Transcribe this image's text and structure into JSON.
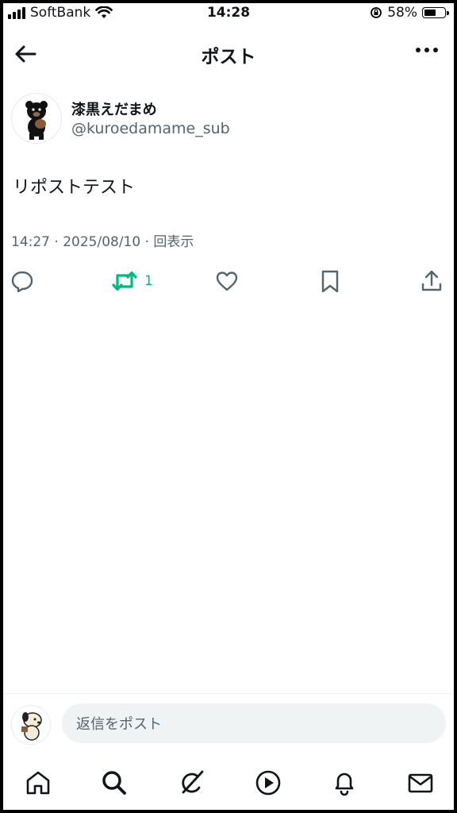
{
  "status_bar": {
    "carrier": "SoftBank",
    "time": "14:28",
    "battery_percent": "58%",
    "battery_level": 0.58,
    "icons": [
      "signal-icon",
      "wifi-icon",
      "orientation-lock-icon",
      "battery-icon"
    ]
  },
  "header": {
    "title": "ポスト",
    "back_icon": "arrow-left-icon",
    "more_icon": "more-horizontal-icon"
  },
  "post": {
    "author": {
      "display_name": "漆黒えだまめ",
      "handle": "@kuroedamame_sub"
    },
    "text": "リポストテスト",
    "timestamp": "14:27 · 2025/08/10 · 回表示",
    "actions": {
      "reply_icon": "reply-icon",
      "repost_icon": "repost-icon",
      "repost_count": "1",
      "like_icon": "heart-icon",
      "bookmark_icon": "bookmark-icon",
      "share_icon": "share-icon"
    }
  },
  "reply_bar": {
    "placeholder": "返信をポスト"
  },
  "tab_bar": {
    "items": [
      "home",
      "search",
      "grok",
      "video",
      "notifications",
      "messages"
    ]
  },
  "colors": {
    "repost_active": "#00ba7c",
    "secondary_text": "#536471",
    "primary_text": "#0f1419",
    "input_bg": "#eff3f4"
  }
}
